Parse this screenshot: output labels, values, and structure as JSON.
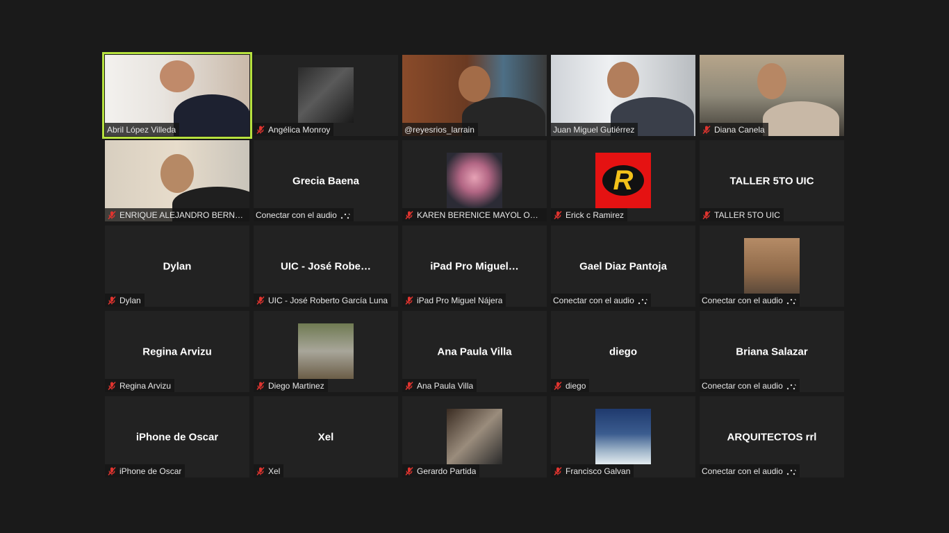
{
  "meeting": {
    "participants": [
      {
        "display_name": "",
        "label": "Abril López Villeda",
        "muted": false,
        "view": "video",
        "active_speaker": true,
        "thumb": "woman-bookshelf"
      },
      {
        "display_name": "",
        "label": "Angélica Monroy",
        "muted": true,
        "view": "photo",
        "thumb": "woman-dark-photo"
      },
      {
        "display_name": "",
        "label": "@reyesrios_larrain",
        "muted": false,
        "view": "video",
        "thumb": "man-library"
      },
      {
        "display_name": "",
        "label": "Juan Miguel Gutiérrez",
        "muted": false,
        "view": "video",
        "thumb": "man-glasses-office"
      },
      {
        "display_name": "",
        "label": "Diana Canela",
        "muted": true,
        "view": "video",
        "thumb": "woman-campus"
      },
      {
        "display_name": "",
        "label": "ENRIQUE ALEJANDRO BERNA…",
        "muted": true,
        "view": "video",
        "thumb": "man-room"
      },
      {
        "display_name": "Grecia Baena",
        "label": "Conectar con el audio",
        "muted": false,
        "view": "name",
        "audio_pending": true
      },
      {
        "display_name": "",
        "label": "KAREN BERENICE MAYOL OR…",
        "muted": true,
        "view": "photo",
        "thumb": "woman-pink-hair"
      },
      {
        "display_name": "",
        "label": "Erick c Ramirez",
        "muted": true,
        "view": "photo",
        "thumb": "robin-logo"
      },
      {
        "display_name": "TALLER 5TO UIC",
        "label": "TALLER 5TO UIC",
        "muted": true,
        "view": "name"
      },
      {
        "display_name": "Dylan",
        "label": "Dylan",
        "muted": true,
        "view": "name"
      },
      {
        "display_name": "UIC - José Robe…",
        "label": "UIC - José Roberto García Luna",
        "muted": true,
        "view": "name"
      },
      {
        "display_name": "iPad Pro Miguel…",
        "label": "iPad Pro Miguel Nájera",
        "muted": true,
        "view": "name"
      },
      {
        "display_name": "Gael Diaz Pantoja",
        "label": "Conectar con el audio",
        "muted": false,
        "view": "name",
        "audio_pending": true
      },
      {
        "display_name": "",
        "label": "Conectar con el audio",
        "muted": false,
        "view": "photo",
        "audio_pending": true,
        "thumb": "man-wood-wall"
      },
      {
        "display_name": "Regina Arvizu",
        "label": "Regina Arvizu",
        "muted": true,
        "view": "name"
      },
      {
        "display_name": "",
        "label": "Diego Martinez",
        "muted": true,
        "view": "photo",
        "thumb": "man-garden"
      },
      {
        "display_name": "Ana Paula Villa",
        "label": "Ana Paula Villa",
        "muted": true,
        "view": "name"
      },
      {
        "display_name": "diego",
        "label": "diego",
        "muted": true,
        "view": "name"
      },
      {
        "display_name": "Briana Salazar",
        "label": "Conectar con el audio",
        "muted": false,
        "view": "name",
        "audio_pending": true
      },
      {
        "display_name": "iPhone de Oscar",
        "label": "iPhone de Oscar",
        "muted": true,
        "view": "name"
      },
      {
        "display_name": "Xel",
        "label": "Xel",
        "muted": true,
        "view": "name"
      },
      {
        "display_name": "",
        "label": "Gerardo Partida",
        "muted": true,
        "view": "photo",
        "thumb": "man-portrait"
      },
      {
        "display_name": "",
        "label": "Francisco Galvan",
        "muted": true,
        "view": "photo",
        "thumb": "night-landscape"
      },
      {
        "display_name": "ARQUITECTOS rrl",
        "label": "Conectar con el audio",
        "muted": false,
        "view": "name",
        "audio_pending": true
      }
    ]
  },
  "icons": {
    "muted": "muted-mic-icon",
    "audio": "connect-audio-icon"
  },
  "colors": {
    "background": "#1a1a1a",
    "tile": "#222222",
    "active_border": "#b7e23f",
    "muted_icon": "#e0342f"
  }
}
